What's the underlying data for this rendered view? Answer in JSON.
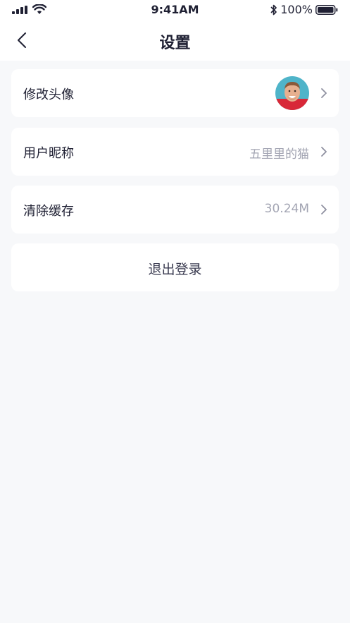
{
  "status_bar": {
    "time": "9:41AM",
    "battery_percent_label": "100%",
    "icons": [
      "signal-icon",
      "wifi-icon",
      "bluetooth-icon",
      "battery-icon"
    ]
  },
  "navbar": {
    "title": "设置",
    "back_icon": "chevron-left-icon"
  },
  "settings": {
    "avatar": {
      "label": "修改头像",
      "chevron": "chevron-right-icon"
    },
    "nickname": {
      "label": "用户昵称",
      "value": "五里里的猫",
      "chevron": "chevron-right-icon"
    },
    "cache": {
      "label": "清除缓存",
      "value": "30.24M",
      "chevron": "chevron-right-icon"
    }
  },
  "logout": {
    "label": "退出登录"
  },
  "colors": {
    "background": "#f7f8fa",
    "card": "#ffffff",
    "text_primary": "#1f2033",
    "text_secondary": "#a3a5b3"
  }
}
